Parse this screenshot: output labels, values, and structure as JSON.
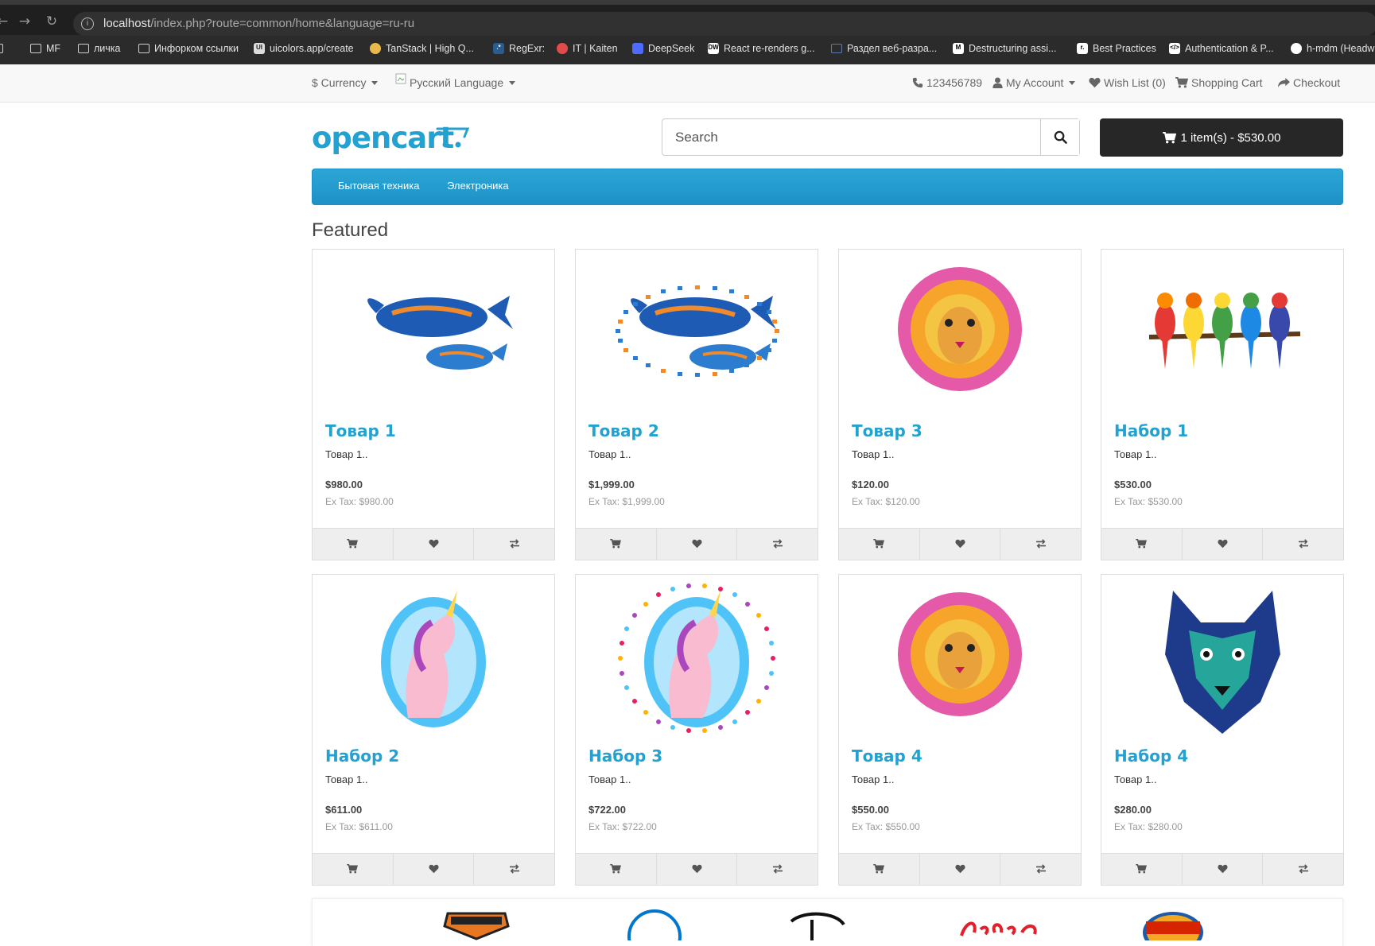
{
  "browser": {
    "url_host": "localhost",
    "url_path": "/index.php?route=common/home&language=ru-ru",
    "bookmarks": [
      {
        "label": "MF"
      },
      {
        "label": "личка"
      },
      {
        "label": "Инфорком ссылки"
      },
      {
        "label": "uicolors.app/create"
      },
      {
        "label": "TanStack | High Q..."
      },
      {
        "label": "RegExr:"
      },
      {
        "label": "IT | Kaiten"
      },
      {
        "label": "DeepSeek"
      },
      {
        "label": "React re-renders g..."
      },
      {
        "label": "Раздел веб-разра..."
      },
      {
        "label": "Destructuring assi..."
      },
      {
        "label": "Best Practices"
      },
      {
        "label": "Authentication & P..."
      },
      {
        "label": "h-mdm (Headw"
      }
    ]
  },
  "topbar": {
    "currency": "$ Currency",
    "language": "Русский Language",
    "phone": "123456789",
    "my_account": "My Account",
    "wishlist": "Wish List (0)",
    "cart": "Shopping Cart",
    "checkout": "Checkout"
  },
  "header": {
    "logo": "opencart",
    "search_placeholder": "Search",
    "cart_summary": "1 item(s) - $530.00"
  },
  "menu": {
    "items": [
      {
        "label": "Бытовая техника"
      },
      {
        "label": "Электроника"
      }
    ]
  },
  "featured": {
    "title": "Featured",
    "products": [
      {
        "name": "Товар 1",
        "desc": "Товар 1..",
        "price": "$980.00",
        "extax": "Ex Tax: $980.00",
        "image": "whales-puzzle"
      },
      {
        "name": "Товар 2",
        "desc": "Товар 1..",
        "price": "$1,999.00",
        "extax": "Ex Tax: $1,999.00",
        "image": "whales-puzzle-pieces"
      },
      {
        "name": "Товар 3",
        "desc": "Товар 1..",
        "price": "$120.00",
        "extax": "Ex Tax: $120.00",
        "image": "lion-puzzle"
      },
      {
        "name": "Набор 1",
        "desc": "Товар 1..",
        "price": "$530.00",
        "extax": "Ex Tax: $530.00",
        "image": "parrots-puzzle"
      },
      {
        "name": "Набор 2",
        "desc": "Товар 1..",
        "price": "$611.00",
        "extax": "Ex Tax: $611.00",
        "image": "unicorn-puzzle"
      },
      {
        "name": "Набор 3",
        "desc": "Товар 1..",
        "price": "$722.00",
        "extax": "Ex Tax: $722.00",
        "image": "unicorn-puzzle-pieces"
      },
      {
        "name": "Товар 4",
        "desc": "Товар 1..",
        "price": "$550.00",
        "extax": "Ex Tax: $550.00",
        "image": "lion-puzzle"
      },
      {
        "name": "Набор 4",
        "desc": "Товар 1..",
        "price": "$280.00",
        "extax": "Ex Tax: $280.00",
        "image": "wolf-puzzle"
      }
    ]
  },
  "brands": [
    "harley-davidson-logo",
    "dell-logo",
    "disney-logo",
    "coca-cola-logo",
    "burger-king-logo"
  ],
  "colors": {
    "accent": "#23a1d1",
    "dark": "#272727",
    "menu": "#229ac8"
  }
}
